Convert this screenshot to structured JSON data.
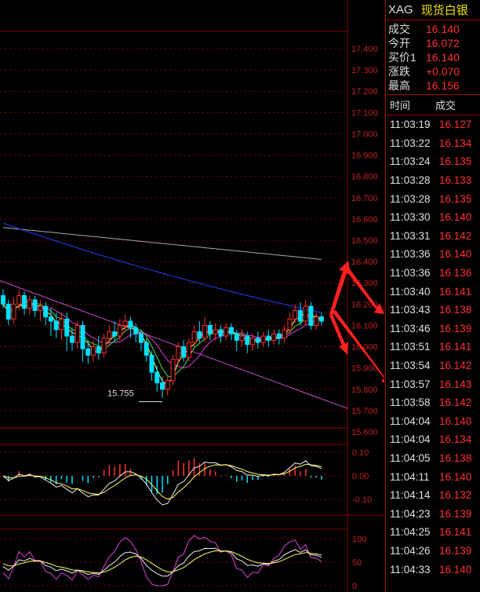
{
  "quote": {
    "symbol_code": "XAG",
    "symbol_name": "现货白银",
    "rows": [
      {
        "label": "成交",
        "value": "16.140"
      },
      {
        "label": "今开",
        "value": "16.072"
      },
      {
        "label": "买价1",
        "value": "16.140"
      },
      {
        "label": "涨跌",
        "value": "+0.070"
      },
      {
        "label": "最高",
        "value": "16.156"
      }
    ]
  },
  "ticks": {
    "header_time": "时间",
    "header_price": "成交",
    "rows": [
      {
        "time": "11:03:19",
        "price": "16.127"
      },
      {
        "time": "11:03:22",
        "price": "16.134"
      },
      {
        "time": "11:03:24",
        "price": "16.135"
      },
      {
        "time": "11:03:28",
        "price": "16.133"
      },
      {
        "time": "11:03:28",
        "price": "16.135"
      },
      {
        "time": "11:03:30",
        "price": "16.140"
      },
      {
        "time": "11:03:31",
        "price": "16.142"
      },
      {
        "time": "11:03:36",
        "price": "16.140"
      },
      {
        "time": "11:03:36",
        "price": "16.136"
      },
      {
        "time": "11:03:40",
        "price": "16.141"
      },
      {
        "time": "11:03:43",
        "price": "16.138"
      },
      {
        "time": "11:03:46",
        "price": "16.139"
      },
      {
        "time": "11:03:51",
        "price": "16.141"
      },
      {
        "time": "11:03:54",
        "price": "16.142"
      },
      {
        "time": "11:03:57",
        "price": "16.143"
      },
      {
        "time": "11:03:58",
        "price": "16.142"
      },
      {
        "time": "11:04:04",
        "price": "16.140"
      },
      {
        "time": "11:04:04",
        "price": "16.134"
      },
      {
        "time": "11:04:05",
        "price": "16.138"
      },
      {
        "time": "11:04:11",
        "price": "16.140"
      },
      {
        "time": "11:04:14",
        "price": "16.132"
      },
      {
        "time": "11:04:23",
        "price": "16.139"
      },
      {
        "time": "11:04:25",
        "price": "16.141"
      },
      {
        "time": "11:04:26",
        "price": "16.139"
      },
      {
        "time": "11:04:33",
        "price": "16.140"
      }
    ]
  },
  "chart_data": {
    "type": "candlestick",
    "price_axis_labels": [
      "17.400",
      "17.300",
      "17.200",
      "17.100",
      "17.000",
      "16.900",
      "16.800",
      "16.700",
      "16.600",
      "16.500",
      "16.400",
      "16.300",
      "16.200",
      "16.100",
      "16.000",
      "15.900",
      "15.800",
      "15.700",
      "15.600"
    ],
    "ylim": [
      15.6,
      17.4
    ],
    "low_annotation": "15.755",
    "macd_axis_labels": [
      "0.10",
      "0.00",
      "-0.10"
    ],
    "macd_ylim": [
      -0.1,
      0.1
    ],
    "kdj_axis_labels": [
      "100",
      "50",
      "0"
    ],
    "kdj_ylim": [
      0,
      100
    ],
    "colors": {
      "up": "#ff3030",
      "down": "#00e0ff",
      "ma_blue": "#2040ff",
      "ma_gray": "#a8a8a8",
      "ma_magenta": "#e040e0",
      "ma_yellow": "#ffff60",
      "ma_green": "#40e040",
      "trendline": "#d050d0",
      "arrow": "#ff2020",
      "grid": "#8a0000"
    },
    "candles": [
      {
        "o": 16.24,
        "c": 16.2,
        "h": 16.27,
        "l": 16.18
      },
      {
        "o": 16.2,
        "c": 16.13,
        "h": 16.22,
        "l": 16.1
      },
      {
        "o": 16.13,
        "c": 16.2,
        "h": 16.23,
        "l": 16.11
      },
      {
        "o": 16.2,
        "c": 16.24,
        "h": 16.27,
        "l": 16.17
      },
      {
        "o": 16.24,
        "c": 16.18,
        "h": 16.26,
        "l": 16.15
      },
      {
        "o": 16.18,
        "c": 16.22,
        "h": 16.24,
        "l": 16.15
      },
      {
        "o": 16.22,
        "c": 16.17,
        "h": 16.24,
        "l": 16.14
      },
      {
        "o": 16.17,
        "c": 16.19,
        "h": 16.22,
        "l": 16.12
      },
      {
        "o": 16.19,
        "c": 16.14,
        "h": 16.21,
        "l": 16.1
      },
      {
        "o": 16.14,
        "c": 16.12,
        "h": 16.18,
        "l": 16.05
      },
      {
        "o": 16.12,
        "c": 16.08,
        "h": 16.16,
        "l": 16.04
      },
      {
        "o": 16.08,
        "c": 16.13,
        "h": 16.16,
        "l": 16.03
      },
      {
        "o": 16.13,
        "c": 16.05,
        "h": 16.16,
        "l": 15.98
      },
      {
        "o": 16.05,
        "c": 16.02,
        "h": 16.09,
        "l": 15.98
      },
      {
        "o": 16.02,
        "c": 16.1,
        "h": 16.12,
        "l": 15.99
      },
      {
        "o": 16.1,
        "c": 15.99,
        "h": 16.12,
        "l": 15.93
      },
      {
        "o": 15.99,
        "c": 15.96,
        "h": 16.03,
        "l": 15.92
      },
      {
        "o": 15.96,
        "c": 16.0,
        "h": 16.03,
        "l": 15.93
      },
      {
        "o": 16.0,
        "c": 15.97,
        "h": 16.05,
        "l": 15.94
      },
      {
        "o": 15.97,
        "c": 16.04,
        "h": 16.06,
        "l": 15.95
      },
      {
        "o": 16.04,
        "c": 16.07,
        "h": 16.1,
        "l": 16.01
      },
      {
        "o": 16.07,
        "c": 16.05,
        "h": 16.12,
        "l": 16.02
      },
      {
        "o": 16.05,
        "c": 16.1,
        "h": 16.13,
        "l": 16.03
      },
      {
        "o": 16.1,
        "c": 16.12,
        "h": 16.15,
        "l": 16.07
      },
      {
        "o": 16.12,
        "c": 16.09,
        "h": 16.14,
        "l": 16.04
      },
      {
        "o": 16.09,
        "c": 16.06,
        "h": 16.11,
        "l": 16.02
      },
      {
        "o": 16.06,
        "c": 16.02,
        "h": 16.08,
        "l": 15.98
      },
      {
        "o": 16.02,
        "c": 15.96,
        "h": 16.04,
        "l": 15.93
      },
      {
        "o": 15.96,
        "c": 15.88,
        "h": 15.98,
        "l": 15.84
      },
      {
        "o": 15.88,
        "c": 15.83,
        "h": 15.91,
        "l": 15.79
      },
      {
        "o": 15.83,
        "c": 15.8,
        "h": 15.86,
        "l": 15.76
      },
      {
        "o": 15.8,
        "c": 15.84,
        "h": 15.86,
        "l": 15.77
      },
      {
        "o": 15.84,
        "c": 15.94,
        "h": 15.96,
        "l": 15.82
      },
      {
        "o": 15.94,
        "c": 16.0,
        "h": 16.02,
        "l": 15.92
      },
      {
        "o": 16.0,
        "c": 15.95,
        "h": 16.03,
        "l": 15.93
      },
      {
        "o": 15.95,
        "c": 16.02,
        "h": 16.04,
        "l": 15.93
      },
      {
        "o": 16.02,
        "c": 16.07,
        "h": 16.1,
        "l": 16.0
      },
      {
        "o": 16.07,
        "c": 16.04,
        "h": 16.12,
        "l": 16.02
      },
      {
        "o": 16.04,
        "c": 16.1,
        "h": 16.14,
        "l": 16.02
      },
      {
        "o": 16.1,
        "c": 16.06,
        "h": 16.12,
        "l": 16.03
      },
      {
        "o": 16.06,
        "c": 16.08,
        "h": 16.11,
        "l": 16.03
      },
      {
        "o": 16.08,
        "c": 16.05,
        "h": 16.1,
        "l": 16.02
      },
      {
        "o": 16.05,
        "c": 16.09,
        "h": 16.11,
        "l": 16.03
      },
      {
        "o": 16.09,
        "c": 16.06,
        "h": 16.11,
        "l": 16.03
      },
      {
        "o": 16.06,
        "c": 16.03,
        "h": 16.08,
        "l": 15.98
      },
      {
        "o": 16.03,
        "c": 16.05,
        "h": 16.08,
        "l": 16.0
      },
      {
        "o": 16.05,
        "c": 16.01,
        "h": 16.07,
        "l": 15.97
      },
      {
        "o": 16.01,
        "c": 16.04,
        "h": 16.06,
        "l": 15.98
      },
      {
        "o": 16.04,
        "c": 16.02,
        "h": 16.07,
        "l": 15.99
      },
      {
        "o": 16.02,
        "c": 16.05,
        "h": 16.07,
        "l": 16.0
      },
      {
        "o": 16.05,
        "c": 16.03,
        "h": 16.08,
        "l": 16.0
      },
      {
        "o": 16.03,
        "c": 16.06,
        "h": 16.08,
        "l": 16.01
      },
      {
        "o": 16.06,
        "c": 16.04,
        "h": 16.08,
        "l": 16.01
      },
      {
        "o": 16.04,
        "c": 16.08,
        "h": 16.1,
        "l": 16.02
      },
      {
        "o": 16.08,
        "c": 16.13,
        "h": 16.16,
        "l": 16.06
      },
      {
        "o": 16.13,
        "c": 16.17,
        "h": 16.2,
        "l": 16.11
      },
      {
        "o": 16.17,
        "c": 16.12,
        "h": 16.21,
        "l": 16.1
      },
      {
        "o": 16.12,
        "c": 16.19,
        "h": 16.22,
        "l": 16.1
      },
      {
        "o": 16.19,
        "c": 16.1,
        "h": 16.21,
        "l": 16.08
      },
      {
        "o": 16.1,
        "c": 16.14,
        "h": 16.16,
        "l": 16.08
      },
      {
        "o": 16.14,
        "c": 16.12,
        "h": 16.16,
        "l": 16.1
      }
    ]
  }
}
